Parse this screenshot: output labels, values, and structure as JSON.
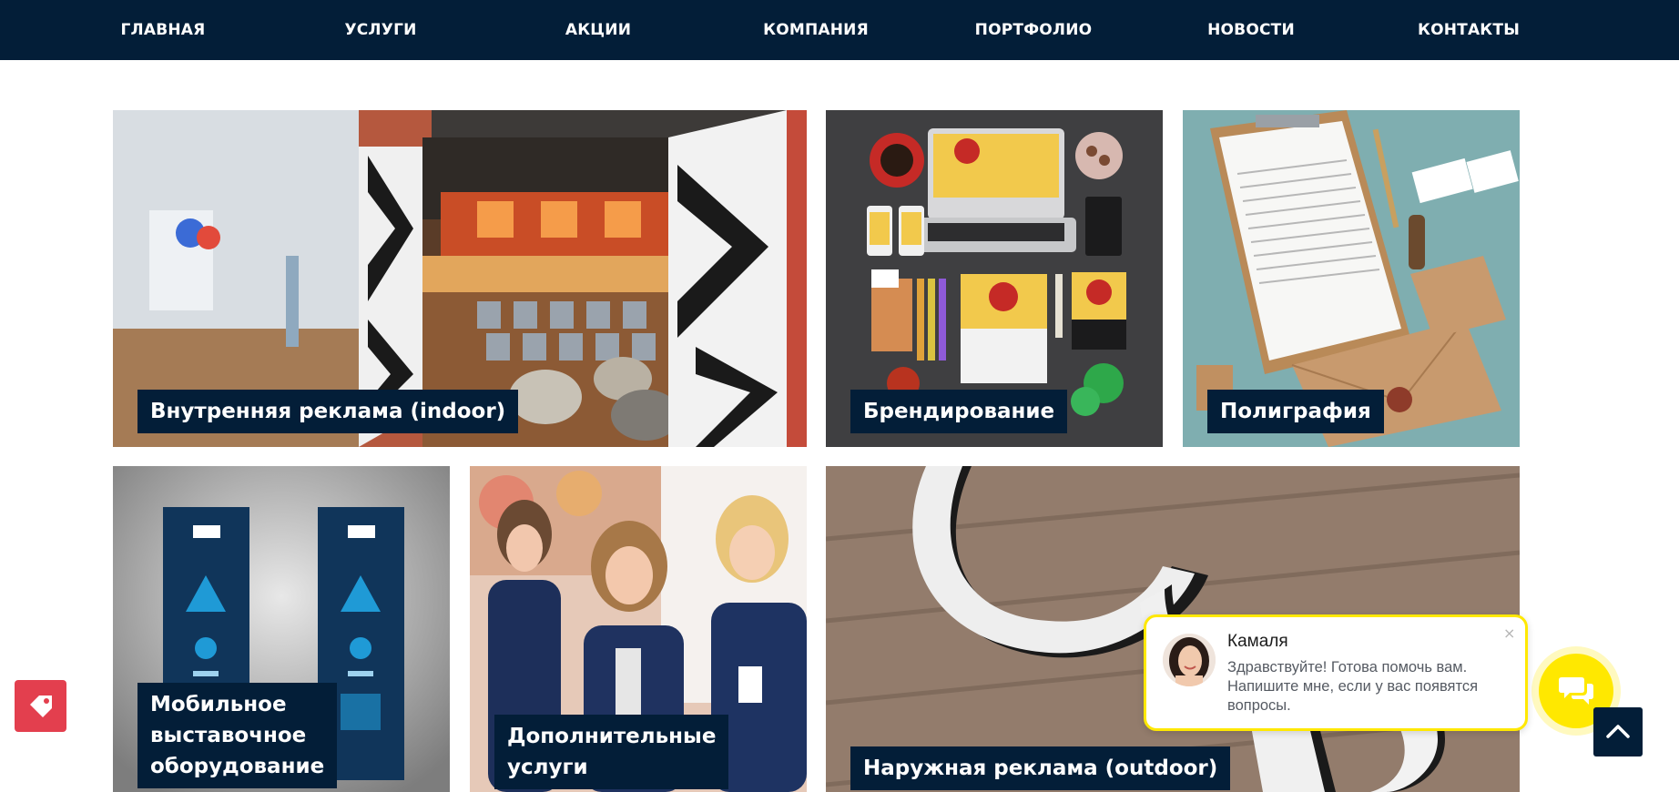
{
  "nav": {
    "items": [
      {
        "label": "ГЛАВНАЯ"
      },
      {
        "label": "УСЛУГИ"
      },
      {
        "label": "АКЦИИ"
      },
      {
        "label": "КОМПАНИЯ"
      },
      {
        "label": "ПОРТФОЛИО"
      },
      {
        "label": "НОВОСТИ"
      },
      {
        "label": "КОНТАКТЫ"
      }
    ]
  },
  "tiles": [
    {
      "line1": "Внутренняя реклама (indoor)"
    },
    {
      "line1": "Брендирование"
    },
    {
      "line1": "Полиграфия"
    },
    {
      "line1": "Мобильное",
      "line2": "выставочное",
      "line3": "оборудование"
    },
    {
      "line1": "Дополнительные",
      "line2": "услуги"
    },
    {
      "line1": "Наружная реклама (outdoor)"
    }
  ],
  "chat": {
    "name": "Камаля",
    "message": "Здравствуйте! Готова помочь вам. Напишите мне, если у вас появятся вопросы.",
    "close": "×"
  },
  "icons": {
    "promo": "tag-icon",
    "chat": "chat-icon",
    "scroll_up": "chevron-up-icon"
  },
  "colors": {
    "nav_bg": "#031e38",
    "label_bg": "#031e38",
    "chat_accent": "#ffe800",
    "promo": "#e33f4e"
  }
}
